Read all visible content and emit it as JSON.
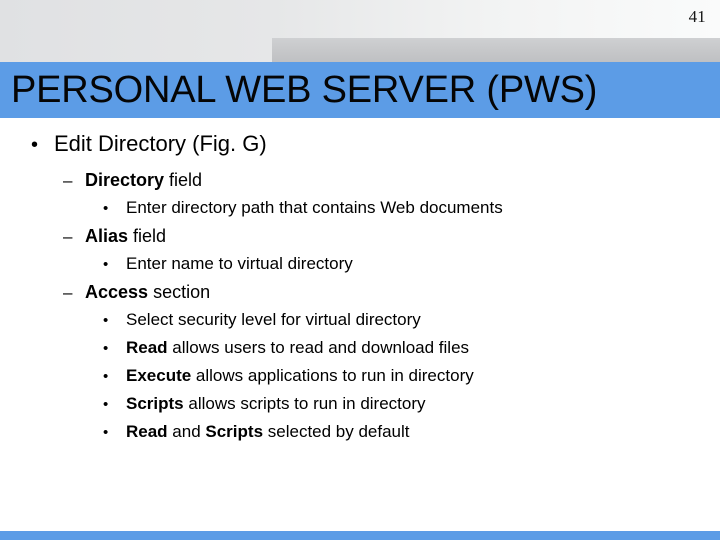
{
  "slide": {
    "page_number": "41",
    "title": "PERSONAL WEB SERVER (PWS)",
    "colors": {
      "accent_blue": "#5c9ce6",
      "header_gray": "#c6c7c9",
      "header_light": "#e6e7e8",
      "text_black": "#000000"
    },
    "bullets": [
      {
        "level": 1,
        "marker": "•",
        "segments": [
          {
            "text": "Edit Directory (Fig. G)",
            "bold": false
          }
        ]
      },
      {
        "level": 2,
        "marker": "–",
        "segments": [
          {
            "text": "Directory",
            "bold": true
          },
          {
            "text": " field",
            "bold": false
          }
        ]
      },
      {
        "level": 3,
        "marker": "•",
        "segments": [
          {
            "text": "Enter directory path that contains Web documents",
            "bold": false
          }
        ]
      },
      {
        "level": 2,
        "marker": "–",
        "segments": [
          {
            "text": "Alias",
            "bold": true
          },
          {
            "text": " field",
            "bold": false
          }
        ]
      },
      {
        "level": 3,
        "marker": "•",
        "segments": [
          {
            "text": "Enter name to virtual directory",
            "bold": false
          }
        ]
      },
      {
        "level": 2,
        "marker": "–",
        "segments": [
          {
            "text": "Access",
            "bold": true
          },
          {
            "text": " section",
            "bold": false
          }
        ]
      },
      {
        "level": 3,
        "marker": "•",
        "segments": [
          {
            "text": "Select security level for virtual directory",
            "bold": false
          }
        ]
      },
      {
        "level": 3,
        "marker": "•",
        "segments": [
          {
            "text": "Read",
            "bold": true
          },
          {
            "text": " allows users to read and download files",
            "bold": false
          }
        ]
      },
      {
        "level": 3,
        "marker": "•",
        "segments": [
          {
            "text": "Execute",
            "bold": true
          },
          {
            "text": " allows applications to run in directory",
            "bold": false
          }
        ]
      },
      {
        "level": 3,
        "marker": "•",
        "segments": [
          {
            "text": "Scripts",
            "bold": true
          },
          {
            "text": " allows scripts to run in directory",
            "bold": false
          }
        ]
      },
      {
        "level": 3,
        "marker": "•",
        "segments": [
          {
            "text": "Read",
            "bold": true
          },
          {
            "text": " and ",
            "bold": false
          },
          {
            "text": "Scripts",
            "bold": true
          },
          {
            "text": " selected by default",
            "bold": false
          }
        ]
      }
    ]
  }
}
